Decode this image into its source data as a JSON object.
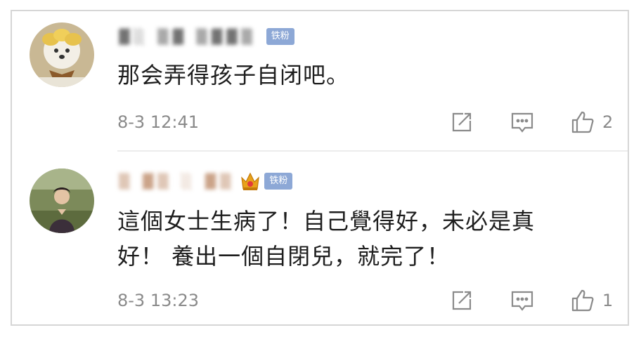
{
  "comments": [
    {
      "username": "▓░ ▒▓ ▒▓▓▒",
      "badge": "铁粉",
      "text": "那会弄得孩子自闭吧。",
      "time": "8-3 12:41",
      "likes": "2",
      "avatar_icon": "dog-avatar"
    },
    {
      "username": "▒ ▓▒ ░ ▓▒",
      "badge": "铁粉",
      "text_line1": "這個女士生病了！自己覺得好，未必是真",
      "text_line2": "好！ 養出一個自閉兒，就完了！",
      "time": "8-3 13:23",
      "likes": "1",
      "avatar_icon": "woman-avatar",
      "crown_icon": "crown-icon"
    }
  ],
  "colors": {
    "badge": "#8da8d6",
    "text": "#1e1e1e",
    "meta": "#8a8a8a",
    "crown": "#e8a21a"
  },
  "icons": [
    "share-icon",
    "reply-icon",
    "like-icon"
  ]
}
